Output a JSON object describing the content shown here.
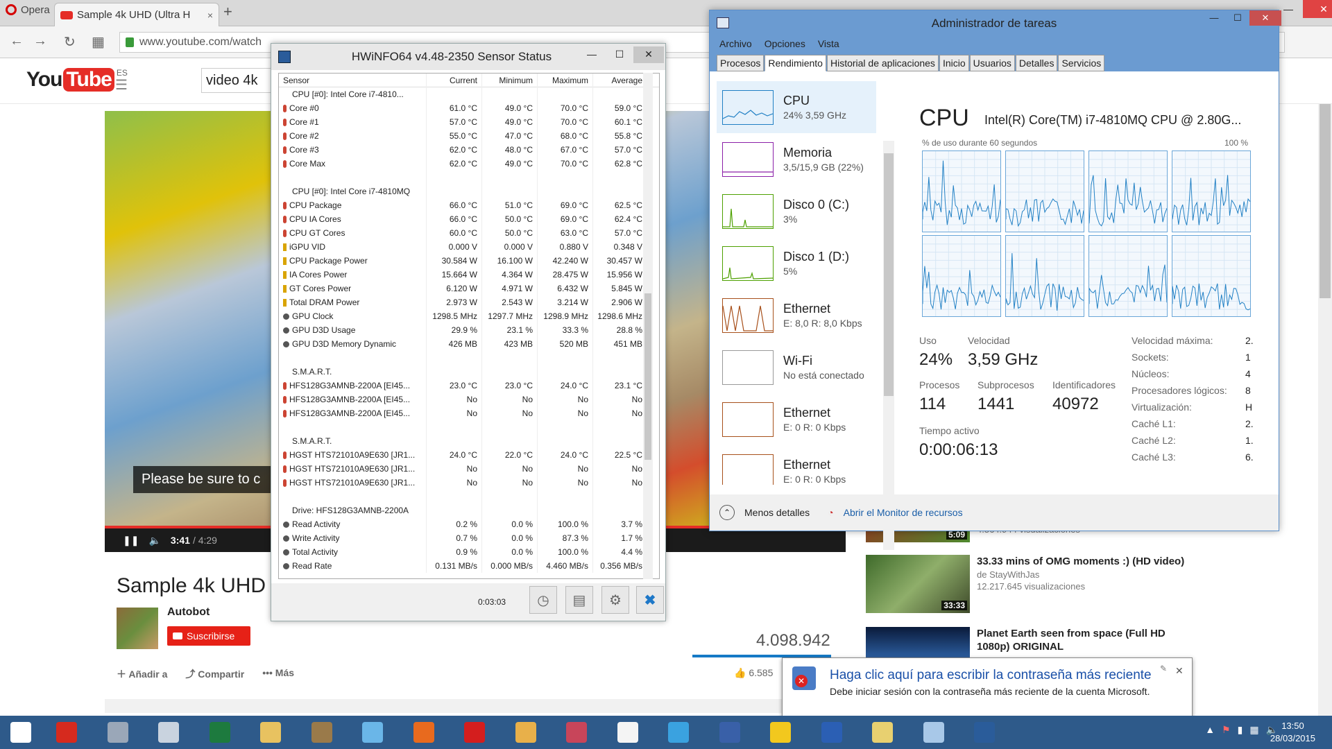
{
  "browser": {
    "menu_label": "Opera",
    "tab_title": "Sample 4k UHD (Ultra H",
    "tab_close": "×",
    "new_tab": "+",
    "url": "www.youtube.com/watch"
  },
  "youtube": {
    "logo_you": "You",
    "logo_tube": "Tube",
    "region": "ES",
    "search_value": "video 4k",
    "caption": "Please be sure to c",
    "time_current": "3:41",
    "time_total": "/ 4:29",
    "progress": 0.82,
    "title": "Sample 4k UHD",
    "channel": "Autobot",
    "subscribe": "Suscribirse",
    "views": "4.098.942",
    "actions": [
      "Añadir a",
      "Compartir",
      "Más"
    ],
    "likes": "6.585",
    "related": [
      {
        "title": "",
        "channel": "",
        "views": "4.564.944 visualizaciones",
        "duration": "5:09"
      },
      {
        "title": "33.33 mins of OMG moments :) (HD video)",
        "channel": "de StayWithJas",
        "views": "12.217.645 visualizaciones",
        "duration": "33:33"
      },
      {
        "title": "Planet Earth seen from space (Full HD 1080p) ORIGINAL",
        "channel": "",
        "views": "",
        "duration": ""
      }
    ]
  },
  "hwinfo": {
    "title": "HWiNFO64 v4.48-2350 Sensor Status",
    "columns": [
      "Sensor",
      "Current",
      "Minimum",
      "Maximum",
      "Average"
    ],
    "rows": [
      {
        "icon": "hdr",
        "name": "CPU [#0]: Intel Core i7-4810...",
        "v": [
          "",
          "",
          "",
          ""
        ]
      },
      {
        "icon": "t",
        "name": "Core #0",
        "v": [
          "61.0 °C",
          "49.0 °C",
          "70.0 °C",
          "59.0 °C"
        ]
      },
      {
        "icon": "t",
        "name": "Core #1",
        "v": [
          "57.0 °C",
          "49.0 °C",
          "70.0 °C",
          "60.1 °C"
        ]
      },
      {
        "icon": "t",
        "name": "Core #2",
        "v": [
          "55.0 °C",
          "47.0 °C",
          "68.0 °C",
          "55.8 °C"
        ]
      },
      {
        "icon": "t",
        "name": "Core #3",
        "v": [
          "62.0 °C",
          "48.0 °C",
          "67.0 °C",
          "57.0 °C"
        ]
      },
      {
        "icon": "t",
        "name": "Core Max",
        "v": [
          "62.0 °C",
          "49.0 °C",
          "70.0 °C",
          "62.8 °C"
        ]
      },
      {
        "icon": "",
        "name": "",
        "v": [
          "",
          "",
          "",
          ""
        ]
      },
      {
        "icon": "hdr",
        "name": "CPU [#0]: Intel Core i7-4810MQ",
        "v": [
          "",
          "",
          "",
          ""
        ]
      },
      {
        "icon": "t",
        "name": "CPU Package",
        "v": [
          "66.0 °C",
          "51.0 °C",
          "69.0 °C",
          "62.5 °C"
        ]
      },
      {
        "icon": "t",
        "name": "CPU IA Cores",
        "v": [
          "66.0 °C",
          "50.0 °C",
          "69.0 °C",
          "62.4 °C"
        ]
      },
      {
        "icon": "t",
        "name": "CPU GT Cores",
        "v": [
          "60.0 °C",
          "50.0 °C",
          "63.0 °C",
          "57.0 °C"
        ]
      },
      {
        "icon": "v",
        "name": "iGPU VID",
        "v": [
          "0.000 V",
          "0.000 V",
          "0.880 V",
          "0.348 V"
        ]
      },
      {
        "icon": "v",
        "name": "CPU Package Power",
        "v": [
          "30.584 W",
          "16.100 W",
          "42.240 W",
          "30.457 W"
        ]
      },
      {
        "icon": "v",
        "name": "IA Cores Power",
        "v": [
          "15.664 W",
          "4.364 W",
          "28.475 W",
          "15.956 W"
        ]
      },
      {
        "icon": "v",
        "name": "GT Cores Power",
        "v": [
          "6.120 W",
          "4.971 W",
          "6.432 W",
          "5.845 W"
        ]
      },
      {
        "icon": "v",
        "name": "Total DRAM Power",
        "v": [
          "2.973 W",
          "2.543 W",
          "3.214 W",
          "2.906 W"
        ]
      },
      {
        "icon": "c",
        "name": "GPU Clock",
        "v": [
          "1298.5 MHz",
          "1297.7 MHz",
          "1298.9 MHz",
          "1298.6 MHz"
        ]
      },
      {
        "icon": "c",
        "name": "GPU D3D Usage",
        "v": [
          "29.9 %",
          "23.1 %",
          "33.3 %",
          "28.8 %"
        ]
      },
      {
        "icon": "c",
        "name": "GPU D3D Memory Dynamic",
        "v": [
          "426 MB",
          "423 MB",
          "520 MB",
          "451 MB"
        ]
      },
      {
        "icon": "",
        "name": "",
        "v": [
          "",
          "",
          "",
          ""
        ]
      },
      {
        "icon": "hdr",
        "name": "S.M.A.R.T.",
        "v": [
          "",
          "",
          "",
          ""
        ]
      },
      {
        "icon": "t",
        "name": "HFS128G3AMNB-2200A [EI45...",
        "v": [
          "23.0 °C",
          "23.0 °C",
          "24.0 °C",
          "23.1 °C"
        ]
      },
      {
        "icon": "t",
        "name": "HFS128G3AMNB-2200A [EI45...",
        "v": [
          "No",
          "No",
          "No",
          "No"
        ]
      },
      {
        "icon": "t",
        "name": "HFS128G3AMNB-2200A [EI45...",
        "v": [
          "No",
          "No",
          "No",
          "No"
        ]
      },
      {
        "icon": "",
        "name": "",
        "v": [
          "",
          "",
          "",
          ""
        ]
      },
      {
        "icon": "hdr",
        "name": "S.M.A.R.T.",
        "v": [
          "",
          "",
          "",
          ""
        ]
      },
      {
        "icon": "t",
        "name": "HGST HTS721010A9E630 [JR1...",
        "v": [
          "24.0 °C",
          "22.0 °C",
          "24.0 °C",
          "22.5 °C"
        ]
      },
      {
        "icon": "t",
        "name": "HGST HTS721010A9E630 [JR1...",
        "v": [
          "No",
          "No",
          "No",
          "No"
        ]
      },
      {
        "icon": "t",
        "name": "HGST HTS721010A9E630 [JR1...",
        "v": [
          "No",
          "No",
          "No",
          "No"
        ]
      },
      {
        "icon": "",
        "name": "",
        "v": [
          "",
          "",
          "",
          ""
        ]
      },
      {
        "icon": "hdr",
        "name": "Drive: HFS128G3AMNB-2200A",
        "v": [
          "",
          "",
          "",
          ""
        ]
      },
      {
        "icon": "c",
        "name": "Read Activity",
        "v": [
          "0.2 %",
          "0.0 %",
          "100.0 %",
          "3.7 %"
        ]
      },
      {
        "icon": "c",
        "name": "Write Activity",
        "v": [
          "0.7 %",
          "0.0 %",
          "87.3 %",
          "1.7 %"
        ]
      },
      {
        "icon": "c",
        "name": "Total Activity",
        "v": [
          "0.9 %",
          "0.0 %",
          "100.0 %",
          "4.4 %"
        ]
      },
      {
        "icon": "c",
        "name": "Read Rate",
        "v": [
          "0.131 MB/s",
          "0.000 MB/s",
          "4.460 MB/s",
          "0.356 MB/s"
        ]
      }
    ],
    "elapsed": "0:03:03"
  },
  "taskmgr": {
    "title": "Administrador de tareas",
    "menu": [
      "Archivo",
      "Opciones",
      "Vista"
    ],
    "tabs": [
      "Procesos",
      "Rendimiento",
      "Historial de aplicaciones",
      "Inicio",
      "Usuarios",
      "Detalles",
      "Servicios"
    ],
    "resources": [
      {
        "name": "CPU",
        "sub": "24% 3,59 GHz",
        "color": "#1f7fc4"
      },
      {
        "name": "Memoria",
        "sub": "3,5/15,9 GB (22%)",
        "color": "#8b1fa8"
      },
      {
        "name": "Disco 0 (C:)",
        "sub": "3%",
        "color": "#4da000"
      },
      {
        "name": "Disco 1 (D:)",
        "sub": "5%",
        "color": "#4da000"
      },
      {
        "name": "Ethernet",
        "sub": "E: 8,0 R: 8,0 Kbps",
        "color": "#a7501b"
      },
      {
        "name": "Wi-Fi",
        "sub": "No está conectado",
        "color": "#999999"
      },
      {
        "name": "Ethernet",
        "sub": "E: 0 R: 0 Kbps",
        "color": "#a7501b"
      },
      {
        "name": "Ethernet",
        "sub": "E: 0 R: 0 Kbps",
        "color": "#a7501b"
      }
    ],
    "cpu_title": "CPU",
    "cpu_model": "Intel(R) Core(TM) i7-4810MQ CPU @ 2.80G...",
    "graph_label": "% de uso durante 60 segundos",
    "graph_max": "100 %",
    "stats": {
      "uso_label": "Uso",
      "uso": "24%",
      "vel_label": "Velocidad",
      "vel": "3,59 GHz",
      "proc_label": "Procesos",
      "proc": "114",
      "sub_label": "Subprocesos",
      "sub": "1441",
      "id_label": "Identificadores",
      "id": "40972",
      "up_label": "Tiempo activo",
      "up": "0:00:06:13"
    },
    "specs": [
      {
        "k": "Velocidad máxima:",
        "v": "2."
      },
      {
        "k": "Sockets:",
        "v": "1"
      },
      {
        "k": "Núcleos:",
        "v": "4"
      },
      {
        "k": "Procesadores lógicos:",
        "v": "8"
      },
      {
        "k": "Virtualización:",
        "v": "H"
      },
      {
        "k": "Caché L1:",
        "v": "2."
      },
      {
        "k": "Caché L2:",
        "v": "1."
      },
      {
        "k": "Caché L3:",
        "v": "6."
      }
    ],
    "less_details": "Menos detalles",
    "open_monitor": "Abrir el Monitor de recursos"
  },
  "notification": {
    "title": "Haga clic aquí para escribir la contraseña más reciente",
    "body": "Debe iniciar sesión con la contraseña más reciente de la cuenta Microsoft."
  },
  "taskbar": {
    "time": "13:50",
    "date": "28/03/2015",
    "apps": [
      {
        "name": "windows-start",
        "color": "#ffffff"
      },
      {
        "name": "acrobat",
        "color": "#d62a1e"
      },
      {
        "name": "app-elephant",
        "color": "#9aa7b8"
      },
      {
        "name": "calculator",
        "color": "#c9d3df"
      },
      {
        "name": "excel",
        "color": "#1d7a3e"
      },
      {
        "name": "explorer",
        "color": "#e8c260"
      },
      {
        "name": "disc",
        "color": "#9a7a4a"
      },
      {
        "name": "network-app",
        "color": "#6ab6e8"
      },
      {
        "name": "firefox",
        "color": "#e86a1e"
      },
      {
        "name": "opera",
        "color": "#d41e1e"
      },
      {
        "name": "paint",
        "color": "#e8b04a"
      },
      {
        "name": "snipping",
        "color": "#c8455a"
      },
      {
        "name": "document",
        "color": "#f4f4f4"
      },
      {
        "name": "telegram",
        "color": "#3aa2e0"
      },
      {
        "name": "visio",
        "color": "#3960a8"
      },
      {
        "name": "sticky",
        "color": "#f2c81e"
      },
      {
        "name": "word",
        "color": "#2b5fb4"
      },
      {
        "name": "folder",
        "color": "#e8d070"
      },
      {
        "name": "taskmgr-app",
        "color": "#a8c8e8"
      },
      {
        "name": "hwinfo-app",
        "color": "#2a5c9a"
      }
    ]
  }
}
